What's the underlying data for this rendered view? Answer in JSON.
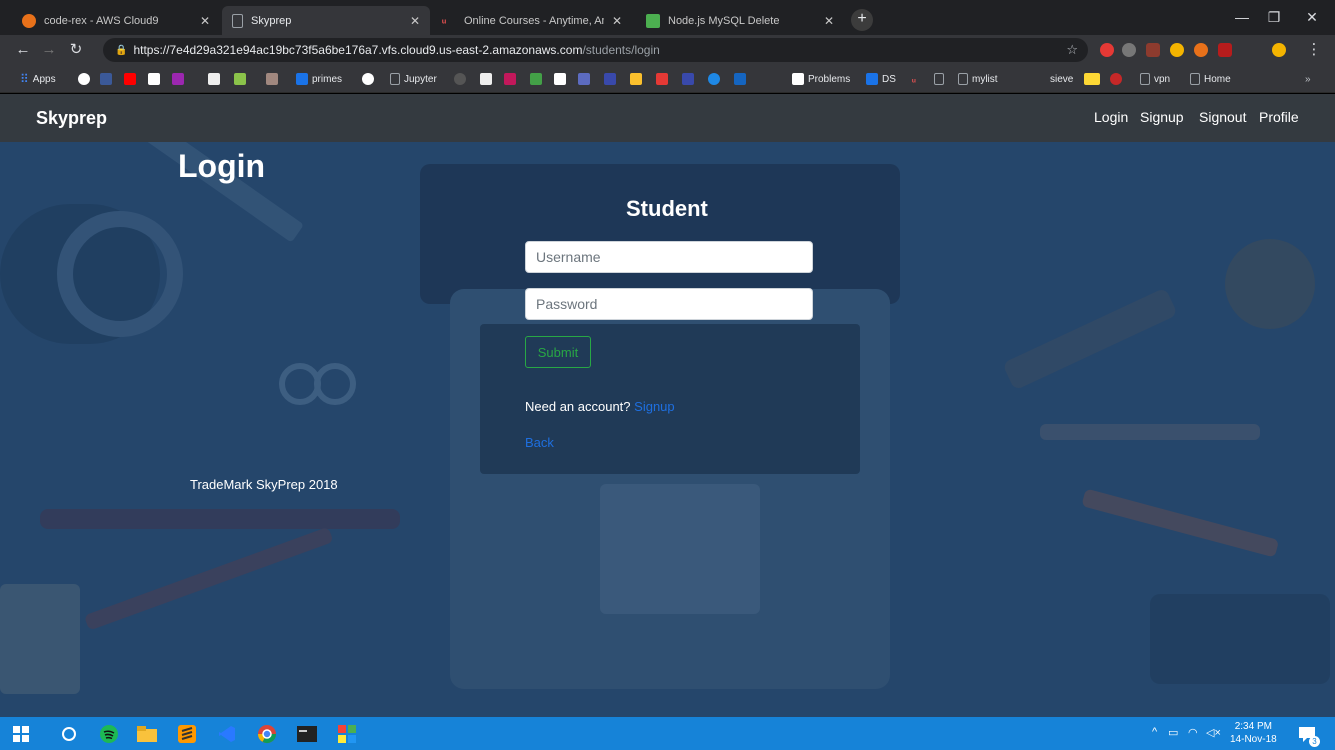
{
  "browser": {
    "tabs": [
      {
        "title": "code-rex - AWS Cloud9",
        "icon": "aws-cloud9-icon",
        "favicon_color": "#e8711a",
        "active": false
      },
      {
        "title": "Skyprep",
        "icon": "page-icon",
        "favicon_color": "#9aa0a6",
        "active": true
      },
      {
        "title": "Online Courses - Anytime, Anywh",
        "icon": "udemy-icon",
        "favicon_color": "#ec5252",
        "active": false
      },
      {
        "title": "Node.js MySQL Delete",
        "icon": "w3schools-icon",
        "favicon_color": "#4caf50",
        "active": false
      }
    ],
    "url": {
      "base": "https://7e4d29a321e94ac19bc73f5a6be176a7.vfs.cloud9.us-east-2.amazonaws.com",
      "path": "/students/login"
    },
    "bookmarks": [
      {
        "label": "Apps",
        "icon": "apps-grid-icon",
        "color": "#4285f4"
      },
      {
        "label": "primes",
        "icon": "primes-icon",
        "color": "#1a73e8"
      },
      {
        "label": "Jupyter",
        "icon": "page-icon",
        "color": "#9aa0a6"
      },
      {
        "label": "Problems",
        "icon": "codechef-icon",
        "color": "#5b4638"
      },
      {
        "label": "DS",
        "icon": "ds-icon",
        "color": "#1a73e8"
      },
      {
        "label": "mylist",
        "icon": "page-icon",
        "color": "#9aa0a6"
      },
      {
        "label": "sieve",
        "icon": "blank-icon",
        "color": "#35363a"
      },
      {
        "label": "vpn",
        "icon": "page-icon",
        "color": "#9aa0a6"
      },
      {
        "label": "Home",
        "icon": "page-icon",
        "color": "#9aa0a6"
      }
    ]
  },
  "site": {
    "brand": "Skyprep",
    "nav": [
      "Login",
      "Signup",
      "Signout",
      "Profile"
    ],
    "heading": "Login",
    "subheading": "Student",
    "username_placeholder": "Username",
    "password_placeholder": "Password",
    "submit_label": "Submit",
    "need_account_text": "Need an account?",
    "signup_link": "Signup",
    "back_link": "Back",
    "footer": "TradeMark SkyPrep 2018"
  },
  "taskbar": {
    "time": "2:34 PM",
    "date": "14-Nov-18",
    "notification_count": "3"
  },
  "colors": {
    "navbar_bg": "#343a40",
    "page_overlay": "#1e3f66",
    "submit_green": "#28a745",
    "link_blue": "#1e6fe0",
    "taskbar_blue": "#1683d8"
  }
}
